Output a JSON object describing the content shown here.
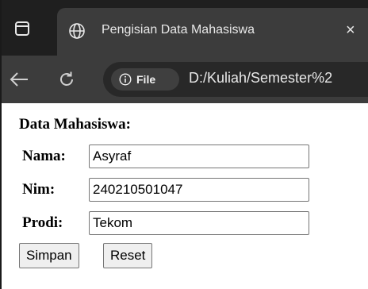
{
  "browser": {
    "tab": {
      "title": "Pengisian Data Mahasiswa",
      "close_glyph": "×",
      "favicon": "globe-icon"
    },
    "toolbar": {
      "chip_label": "File",
      "url": "D:/Kuliah/Semester%2",
      "icons": [
        "back-arrow-icon",
        "reload-icon",
        "info-icon"
      ]
    }
  },
  "form": {
    "heading": "Data Mahasiswa:",
    "fields": [
      {
        "label": "Nama:",
        "value": "Asyraf"
      },
      {
        "label": "Nim:",
        "value": "240210501047"
      },
      {
        "label": "Prodi:",
        "value": "Tekom"
      }
    ],
    "buttons": {
      "submit": "Simpan",
      "reset": "Reset"
    }
  },
  "colors": {
    "tabstrip_bg": "#1f1f1f",
    "toolbar_bg": "#3c3c3c",
    "omnibox_bg": "#282828",
    "page_bg": "#ffffff",
    "button_bg": "#efefef"
  }
}
